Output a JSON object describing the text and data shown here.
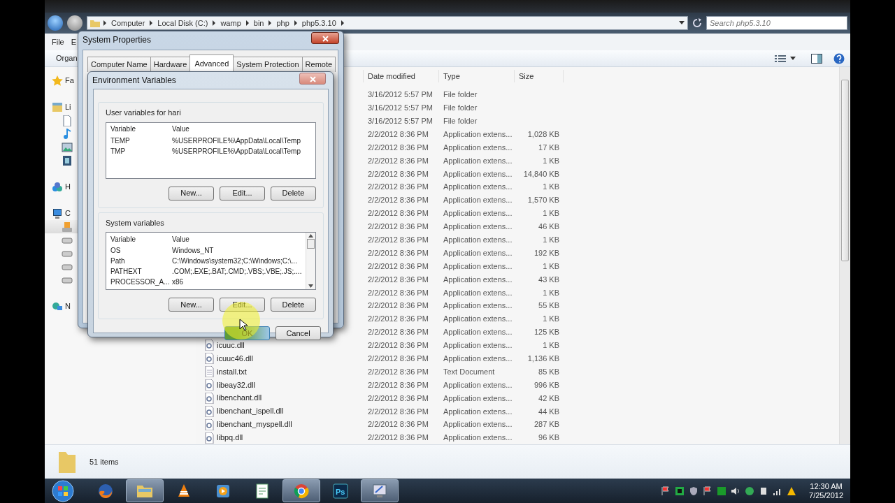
{
  "explorer": {
    "crumbs": [
      "Computer",
      "Local Disk (C:)",
      "wamp",
      "bin",
      "php",
      "php5.3.10"
    ],
    "search": {
      "placeholder": "Search php5.3.10"
    },
    "menu": [
      "File",
      "E"
    ],
    "toolbar": {
      "organize": "Organ"
    },
    "sidebar": [
      {
        "kind": "favorites",
        "label": "Fa",
        "selected": false
      },
      {
        "kind": "library",
        "label": "Li",
        "selected": false,
        "children": [
          {
            "kind": "document",
            "selected": false
          },
          {
            "kind": "music",
            "selected": false
          },
          {
            "kind": "pictures",
            "selected": false
          },
          {
            "kind": "video",
            "selected": false
          }
        ]
      },
      {
        "kind": "homegroup",
        "label": "H",
        "selected": false
      },
      {
        "kind": "computer",
        "label": "C",
        "selected": false,
        "children": [
          {
            "kind": "system-drive",
            "selected": true
          },
          {
            "kind": "drive",
            "selected": false
          },
          {
            "kind": "drive",
            "selected": false
          },
          {
            "kind": "drive",
            "selected": false
          },
          {
            "kind": "drive",
            "selected": false
          }
        ]
      },
      {
        "kind": "network",
        "label": "N",
        "selected": false
      }
    ],
    "columns": [
      "Date modified",
      "Type",
      "Size"
    ],
    "rows": [
      {
        "date": "3/16/2012 5:57 PM",
        "type": "File folder"
      },
      {
        "date": "3/16/2012 5:57 PM",
        "type": "File folder"
      },
      {
        "date": "3/16/2012 5:57 PM",
        "type": "File folder"
      },
      {
        "date": "2/2/2012 8:36 PM",
        "type": "Application extens...",
        "size": "1,028 KB"
      },
      {
        "date": "2/2/2012 8:36 PM",
        "type": "Application extens...",
        "size": "17 KB"
      },
      {
        "date": "2/2/2012 8:36 PM",
        "type": "Application extens...",
        "size": "1 KB"
      },
      {
        "date": "2/2/2012 8:36 PM",
        "type": "Application extens...",
        "size": "14,840 KB"
      },
      {
        "date": "2/2/2012 8:36 PM",
        "type": "Application extens...",
        "size": "1 KB"
      },
      {
        "date": "2/2/2012 8:36 PM",
        "type": "Application extens...",
        "size": "1,570 KB"
      },
      {
        "date": "2/2/2012 8:36 PM",
        "type": "Application extens...",
        "size": "1 KB"
      },
      {
        "date": "2/2/2012 8:36 PM",
        "type": "Application extens...",
        "size": "46 KB"
      },
      {
        "date": "2/2/2012 8:36 PM",
        "type": "Application extens...",
        "size": "1 KB"
      },
      {
        "date": "2/2/2012 8:36 PM",
        "type": "Application extens...",
        "size": "192 KB"
      },
      {
        "date": "2/2/2012 8:36 PM",
        "type": "Application extens...",
        "size": "1 KB"
      },
      {
        "date": "2/2/2012 8:36 PM",
        "type": "Application extens...",
        "size": "43 KB"
      },
      {
        "date": "2/2/2012 8:36 PM",
        "type": "Application extens...",
        "size": "1 KB"
      },
      {
        "date": "2/2/2012 8:36 PM",
        "type": "Application extens...",
        "size": "55 KB"
      },
      {
        "date": "2/2/2012 8:36 PM",
        "type": "Application extens...",
        "size": "1 KB"
      },
      {
        "date": "2/2/2012 8:36 PM",
        "type": "Application extens...",
        "size": "125 KB"
      },
      {
        "kind": "dll",
        "name": "icuuc.dll",
        "date": "2/2/2012 8:36 PM",
        "type": "Application extens...",
        "size": "1 KB"
      },
      {
        "kind": "dll",
        "name": "icuuc46.dll",
        "date": "2/2/2012 8:36 PM",
        "type": "Application extens...",
        "size": "1,136 KB"
      },
      {
        "kind": "txt",
        "name": "install.txt",
        "date": "2/2/2012 8:36 PM",
        "type": "Text Document",
        "size": "85 KB"
      },
      {
        "kind": "dll",
        "name": "libeay32.dll",
        "date": "2/2/2012 8:36 PM",
        "type": "Application extens...",
        "size": "996 KB"
      },
      {
        "kind": "dll",
        "name": "libenchant.dll",
        "date": "2/2/2012 8:36 PM",
        "type": "Application extens...",
        "size": "42 KB"
      },
      {
        "kind": "dll",
        "name": "libenchant_ispell.dll",
        "date": "2/2/2012 8:36 PM",
        "type": "Application extens...",
        "size": "44 KB"
      },
      {
        "kind": "dll",
        "name": "libenchant_myspell.dll",
        "date": "2/2/2012 8:36 PM",
        "type": "Application extens...",
        "size": "287 KB"
      },
      {
        "kind": "dll",
        "name": "libpq.dll",
        "date": "2/2/2012 8:36 PM",
        "type": "Application extens...",
        "size": "96 KB"
      }
    ],
    "status": "51 items"
  },
  "system_properties": {
    "title": "System Properties",
    "tabs": [
      {
        "label": "Computer Name",
        "selected": false
      },
      {
        "label": "Hardware",
        "selected": false
      },
      {
        "label": "Advanced",
        "selected": true
      },
      {
        "label": "System Protection",
        "selected": false
      },
      {
        "label": "Remote",
        "selected": false
      }
    ]
  },
  "environment_variables": {
    "title": "Environment Variables",
    "groups": [
      {
        "label": "User variables for hari",
        "columns": [
          "Variable",
          "Value"
        ],
        "scrollable": false,
        "rows": [
          {
            "variable": "TEMP",
            "value": "%USERPROFILE%\\AppData\\Local\\Temp"
          },
          {
            "variable": "TMP",
            "value": "%USERPROFILE%\\AppData\\Local\\Temp"
          }
        ],
        "buttons": [
          "New...",
          "Edit...",
          "Delete"
        ]
      },
      {
        "label": "System variables",
        "columns": [
          "Variable",
          "Value"
        ],
        "scrollable": true,
        "rows": [
          {
            "variable": "OS",
            "value": "Windows_NT"
          },
          {
            "variable": "Path",
            "value": "C:\\Windows\\system32;C:\\Windows;C:\\..."
          },
          {
            "variable": "PATHEXT",
            "value": ".COM;.EXE;.BAT;.CMD;.VBS;.VBE;.JS;...."
          },
          {
            "variable": "PROCESSOR_A...",
            "value": "x86"
          }
        ],
        "buttons": [
          "New...",
          "Edit...",
          "Delete"
        ]
      }
    ],
    "footer": [
      {
        "label": "OK",
        "hovered": true
      },
      {
        "label": "Cancel",
        "hovered": false
      }
    ]
  },
  "taskbar": {
    "items": [
      {
        "kind": "firefox",
        "active": false
      },
      {
        "kind": "explorer",
        "active": true
      },
      {
        "kind": "vlc",
        "active": false
      },
      {
        "kind": "media",
        "active": false
      },
      {
        "kind": "notepad",
        "active": false
      },
      {
        "kind": "chrome",
        "active": true
      },
      {
        "kind": "photoshop",
        "label": "Ps",
        "active": false
      },
      {
        "kind": "system",
        "active": true
      }
    ],
    "time": "12:30 AM",
    "date": "7/25/2012"
  }
}
